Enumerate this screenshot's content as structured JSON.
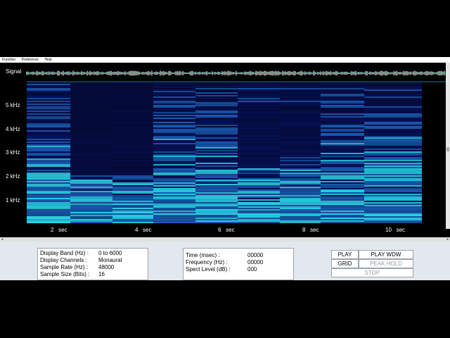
{
  "menu": [
    "Function",
    "Preference",
    "Help"
  ],
  "plot": {
    "signal_label": "Signal",
    "freq_labels": [
      "5 kHz",
      "4 kHz",
      "3 kHz",
      "2 kHz",
      "1 kHz"
    ],
    "time_labels": [
      "2",
      "4",
      "6",
      "8",
      "10"
    ],
    "time_unit": "sec",
    "colors": {
      "background": "#000000",
      "low": "#0a1a8c",
      "mid": "#1f6fe0",
      "high": "#29d6f0",
      "signal": "#f2f0c8",
      "hline": "#1fa7c9"
    }
  },
  "display_info": {
    "band_label": "Display Band (Hz) :",
    "band_value": "0 to 6000",
    "channels_label": "Display Channels :",
    "channels_value": "Monaural",
    "rate_label": "Sample Rate (Hz) :",
    "rate_value": "48000",
    "size_label": "Sample Size (Bits) :",
    "size_value": "16"
  },
  "readout": {
    "time_label": "Time (msec) :",
    "time_value": "00000",
    "freq_label": "Frequency (Hz) :",
    "freq_value": "00000",
    "level_label": "Spect Level (dB) :",
    "level_value": "000"
  },
  "controls": {
    "play": "PLAY",
    "play_wdw": "PLAY WDW",
    "grid": "GRID",
    "peak_hold": "PEAK HOLD",
    "stop": "STOP"
  }
}
